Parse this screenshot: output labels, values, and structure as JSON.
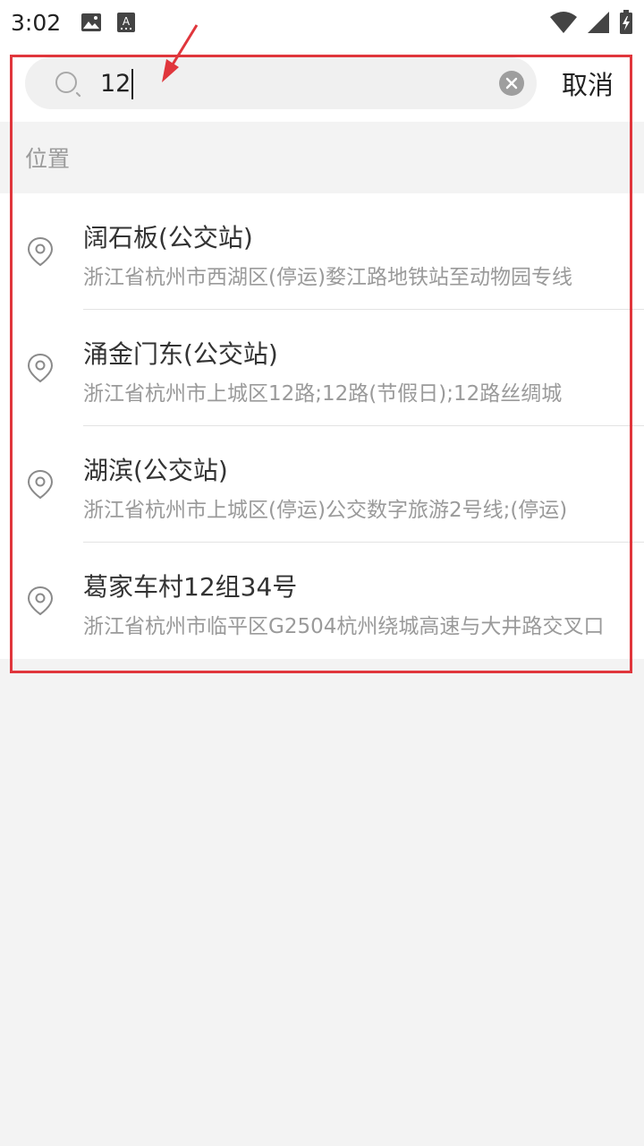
{
  "status_bar": {
    "time": "3:02"
  },
  "search": {
    "value": "12",
    "cancel_label": "取消"
  },
  "section": {
    "title": "位置"
  },
  "results": [
    {
      "title": "阔石板(公交站)",
      "subtitle": "浙江省杭州市西湖区(停运)婺江路地铁站至动物园专线"
    },
    {
      "title": "涌金门东(公交站)",
      "subtitle": "浙江省杭州市上城区12路;12路(节假日);12路丝绸城"
    },
    {
      "title": "湖滨(公交站)",
      "subtitle": "浙江省杭州市上城区(停运)公交数字旅游2号线;(停运)"
    },
    {
      "title": "葛家车村12组34号",
      "subtitle": "浙江省杭州市临平区G2504杭州绕城高速与大井路交叉口"
    }
  ],
  "colors": {
    "highlight": "#e0363c",
    "text_primary": "#333333",
    "text_secondary": "#9a9a9a",
    "background": "#f3f3f3"
  },
  "icons": {
    "status_left": [
      "image-icon",
      "font-icon"
    ],
    "status_right": [
      "wifi-icon",
      "signal-icon",
      "battery-icon"
    ],
    "search": "search-icon",
    "clear": "clear-icon",
    "result": "location-pin-icon"
  }
}
